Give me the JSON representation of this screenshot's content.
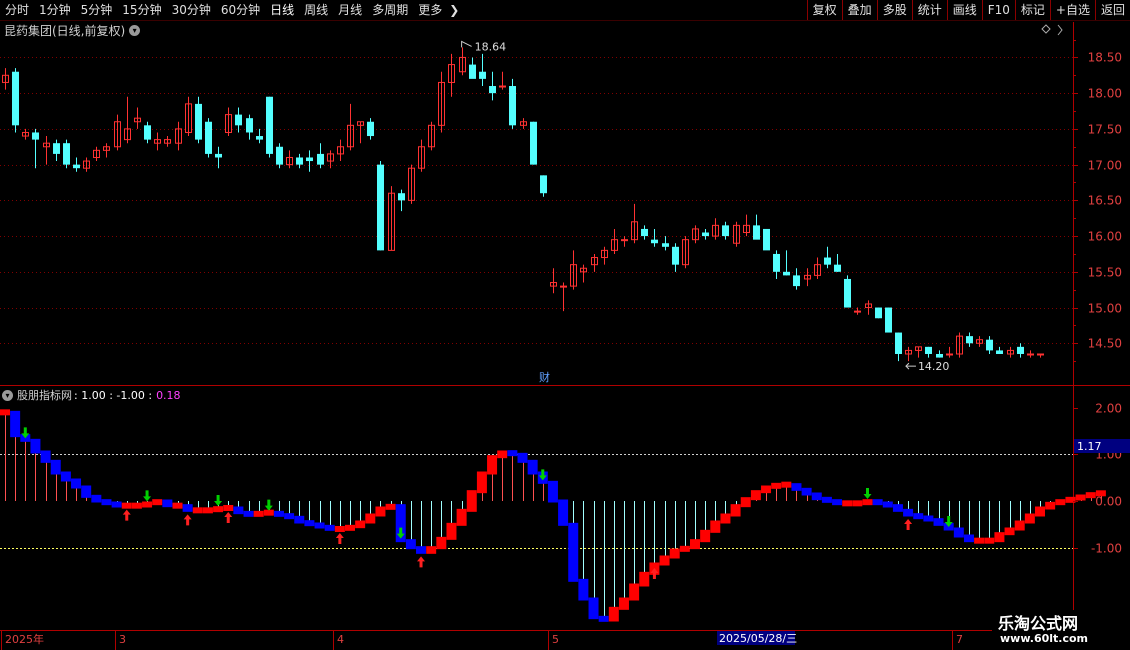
{
  "toolbar": {
    "periods": [
      "分时",
      "1分钟",
      "5分钟",
      "15分钟",
      "30分钟",
      "60分钟",
      "日线",
      "周线",
      "月线",
      "多周期",
      "更多"
    ],
    "active_period": "日线",
    "more_arrow": "❯",
    "right_buttons": [
      "复权",
      "叠加",
      "多股",
      "统计",
      "画线",
      "F10",
      "标记",
      "+自选",
      "返回"
    ]
  },
  "main_chart": {
    "title": "昆药集团(日线,前复权)",
    "high_label": "18.64",
    "low_label": "14.20",
    "fin_marker": "财",
    "y_ticks": [
      "18.50",
      "18.00",
      "17.50",
      "17.00",
      "16.50",
      "16.00",
      "15.50",
      "15.00",
      "14.50"
    ]
  },
  "indicator": {
    "name": "股朋指标网",
    "values_text": ": 1.00 : -1.00 :",
    "last_value": "0.18",
    "y_ticks": [
      "2.00",
      "1.00",
      "0.00",
      "-1.00"
    ],
    "current_badge": "1.17"
  },
  "date_axis": {
    "labels": [
      "2025年",
      "3",
      "4",
      "5",
      "7"
    ],
    "cursor_date": "2025/05/28/三"
  },
  "brand": {
    "name": "乐淘公式网",
    "url": "www.60lt.com"
  },
  "colors": {
    "up": "#ff3232",
    "down": "#54ffff",
    "ind_up": "#ff0000",
    "ind_down": "#0000ff",
    "axis": "#b00000",
    "grid": "#800000",
    "buy_arrow": "#ff2020",
    "sell_arrow": "#00d000"
  },
  "chart_data": {
    "type": "candlestick",
    "ylim": [
      14.0,
      18.8
    ],
    "ohlc": [
      [
        18.15,
        18.35,
        18.05,
        18.25
      ],
      [
        18.3,
        18.35,
        17.45,
        17.55
      ],
      [
        17.4,
        17.5,
        17.35,
        17.45
      ],
      [
        17.45,
        17.5,
        16.95,
        17.35
      ],
      [
        17.25,
        17.4,
        17.0,
        17.3
      ],
      [
        17.3,
        17.35,
        17.05,
        17.15
      ],
      [
        17.3,
        17.35,
        16.95,
        17.0
      ],
      [
        17.0,
        17.1,
        16.9,
        16.95
      ],
      [
        16.95,
        17.1,
        16.9,
        17.05
      ],
      [
        17.1,
        17.25,
        17.05,
        17.2
      ],
      [
        17.2,
        17.3,
        17.1,
        17.25
      ],
      [
        17.25,
        17.7,
        17.2,
        17.6
      ],
      [
        17.35,
        17.95,
        17.3,
        17.5
      ],
      [
        17.6,
        17.8,
        17.5,
        17.65
      ],
      [
        17.55,
        17.6,
        17.3,
        17.35
      ],
      [
        17.3,
        17.45,
        17.2,
        17.35
      ],
      [
        17.3,
        17.4,
        17.25,
        17.35
      ],
      [
        17.3,
        17.6,
        17.2,
        17.5
      ],
      [
        17.45,
        17.95,
        17.4,
        17.85
      ],
      [
        17.85,
        17.95,
        17.3,
        17.35
      ],
      [
        17.6,
        17.65,
        17.1,
        17.15
      ],
      [
        17.15,
        17.25,
        16.95,
        17.1
      ],
      [
        17.45,
        17.8,
        17.4,
        17.7
      ],
      [
        17.7,
        17.8,
        17.45,
        17.55
      ],
      [
        17.65,
        17.7,
        17.35,
        17.45
      ],
      [
        17.4,
        17.5,
        17.3,
        17.35
      ],
      [
        17.95,
        17.95,
        17.1,
        17.15
      ],
      [
        17.25,
        17.3,
        16.95,
        17.0
      ],
      [
        17.0,
        17.2,
        16.95,
        17.1
      ],
      [
        17.1,
        17.15,
        16.95,
        17.0
      ],
      [
        17.1,
        17.2,
        16.9,
        17.05
      ],
      [
        17.15,
        17.3,
        16.95,
        17.0
      ],
      [
        17.05,
        17.2,
        16.95,
        17.15
      ],
      [
        17.15,
        17.35,
        17.05,
        17.25
      ],
      [
        17.25,
        17.85,
        17.2,
        17.55
      ],
      [
        17.55,
        17.6,
        17.3,
        17.6
      ],
      [
        17.6,
        17.65,
        17.35,
        17.4
      ],
      [
        17.0,
        17.05,
        15.8,
        15.8
      ],
      [
        15.8,
        16.7,
        15.8,
        16.6
      ],
      [
        16.6,
        16.65,
        16.35,
        16.5
      ],
      [
        16.5,
        17.0,
        16.45,
        16.95
      ],
      [
        16.95,
        17.35,
        16.9,
        17.25
      ],
      [
        17.25,
        17.6,
        17.2,
        17.55
      ],
      [
        17.55,
        18.3,
        17.45,
        18.15
      ],
      [
        18.15,
        18.55,
        17.95,
        18.4
      ],
      [
        18.3,
        18.64,
        18.25,
        18.5
      ],
      [
        18.4,
        18.5,
        18.25,
        18.2
      ],
      [
        18.3,
        18.55,
        18.1,
        18.2
      ],
      [
        18.1,
        18.3,
        17.9,
        18.0
      ],
      [
        18.1,
        18.3,
        18.05,
        18.1
      ],
      [
        18.1,
        18.2,
        17.5,
        17.55
      ],
      [
        17.55,
        17.65,
        17.5,
        17.6
      ],
      [
        17.6,
        17.6,
        17.0,
        17.0
      ],
      [
        16.85,
        16.85,
        16.55,
        16.6
      ],
      [
        15.3,
        15.55,
        15.2,
        15.35
      ],
      [
        15.3,
        15.35,
        14.95,
        15.3
      ],
      [
        15.3,
        15.8,
        15.25,
        15.6
      ],
      [
        15.5,
        15.6,
        15.35,
        15.55
      ],
      [
        15.6,
        15.75,
        15.5,
        15.7
      ],
      [
        15.7,
        15.85,
        15.6,
        15.8
      ],
      [
        15.8,
        16.1,
        15.75,
        15.95
      ],
      [
        15.95,
        16.0,
        15.85,
        15.95
      ],
      [
        15.95,
        16.45,
        15.9,
        16.2
      ],
      [
        16.1,
        16.15,
        15.95,
        16.0
      ],
      [
        15.95,
        16.1,
        15.85,
        15.9
      ],
      [
        15.9,
        16.0,
        15.8,
        15.85
      ],
      [
        15.85,
        15.9,
        15.5,
        15.6
      ],
      [
        15.6,
        16.0,
        15.55,
        15.95
      ],
      [
        15.95,
        16.15,
        15.9,
        16.1
      ],
      [
        16.05,
        16.1,
        15.95,
        16.0
      ],
      [
        16.0,
        16.25,
        15.95,
        16.15
      ],
      [
        16.15,
        16.2,
        15.95,
        16.0
      ],
      [
        15.9,
        16.2,
        15.85,
        16.15
      ],
      [
        16.05,
        16.3,
        16.0,
        16.15
      ],
      [
        16.15,
        16.3,
        16.0,
        15.95
      ],
      [
        16.1,
        16.1,
        15.85,
        15.8
      ],
      [
        15.75,
        15.8,
        15.4,
        15.5
      ],
      [
        15.5,
        15.8,
        15.45,
        15.45
      ],
      [
        15.45,
        15.55,
        15.25,
        15.3
      ],
      [
        15.4,
        15.55,
        15.3,
        15.45
      ],
      [
        15.45,
        15.7,
        15.4,
        15.6
      ],
      [
        15.7,
        15.85,
        15.55,
        15.6
      ],
      [
        15.6,
        15.75,
        15.5,
        15.5
      ],
      [
        15.4,
        15.45,
        15.0,
        15.0
      ],
      [
        14.95,
        15.0,
        14.9,
        14.95
      ],
      [
        15.0,
        15.1,
        14.9,
        15.05
      ],
      [
        15.0,
        15.0,
        14.85,
        14.85
      ],
      [
        15.0,
        15.0,
        14.65,
        14.65
      ],
      [
        14.65,
        14.65,
        14.25,
        14.35
      ],
      [
        14.35,
        14.45,
        14.25,
        14.4
      ],
      [
        14.4,
        14.45,
        14.3,
        14.45
      ],
      [
        14.45,
        14.45,
        14.3,
        14.35
      ],
      [
        14.35,
        14.4,
        14.3,
        14.3
      ],
      [
        14.35,
        14.45,
        14.3,
        14.35
      ],
      [
        14.35,
        14.65,
        14.3,
        14.6
      ],
      [
        14.6,
        14.65,
        14.45,
        14.5
      ],
      [
        14.5,
        14.6,
        14.45,
        14.55
      ],
      [
        14.55,
        14.6,
        14.35,
        14.4
      ],
      [
        14.4,
        14.45,
        14.35,
        14.35
      ],
      [
        14.35,
        14.45,
        14.3,
        14.4
      ],
      [
        14.45,
        14.5,
        14.3,
        14.35
      ],
      [
        14.35,
        14.4,
        14.3,
        14.35
      ],
      [
        14.35,
        14.35,
        14.3,
        14.35
      ]
    ],
    "indicator": {
      "name": "股朋指标网",
      "ylim": [
        -2.7,
        2.1
      ],
      "ref_lines": [
        1.0,
        -1.0
      ],
      "values": [
        1.9,
        1.4,
        1.3,
        1.05,
        0.85,
        0.6,
        0.45,
        0.3,
        0.1,
        0.0,
        -0.05,
        -0.1,
        -0.1,
        -0.1,
        -0.05,
        0.0,
        -0.1,
        -0.1,
        -0.2,
        -0.2,
        -0.2,
        -0.15,
        -0.15,
        -0.25,
        -0.3,
        -0.25,
        -0.25,
        -0.3,
        -0.35,
        -0.45,
        -0.5,
        -0.55,
        -0.6,
        -0.6,
        -0.55,
        -0.45,
        -0.3,
        -0.15,
        -0.1,
        -0.85,
        -1.0,
        -1.1,
        -1.0,
        -0.8,
        -0.5,
        -0.2,
        0.2,
        0.6,
        0.95,
        1.05,
        1.0,
        0.85,
        0.6,
        0.4,
        0.0,
        -0.5,
        -1.7,
        -2.1,
        -2.5,
        -2.55,
        -2.3,
        -2.1,
        -1.8,
        -1.55,
        -1.35,
        -1.2,
        -1.05,
        -1.0,
        -0.85,
        -0.65,
        -0.45,
        -0.3,
        -0.1,
        0.05,
        0.2,
        0.3,
        0.35,
        0.35,
        0.25,
        0.15,
        0.05,
        0.0,
        -0.05,
        -0.05,
        -0.05,
        0.0,
        -0.05,
        -0.1,
        -0.2,
        -0.3,
        -0.35,
        -0.4,
        -0.5,
        -0.6,
        -0.75,
        -0.85,
        -0.85,
        -0.85,
        -0.7,
        -0.6,
        -0.45,
        -0.3,
        -0.15,
        -0.05,
        0.0,
        0.05,
        0.1,
        0.15,
        0.18
      ]
    },
    "buy_signals": [
      12,
      18,
      22,
      33,
      41,
      64,
      89
    ],
    "sell_signals": [
      2,
      14,
      21,
      26,
      39,
      53,
      85,
      93
    ]
  }
}
